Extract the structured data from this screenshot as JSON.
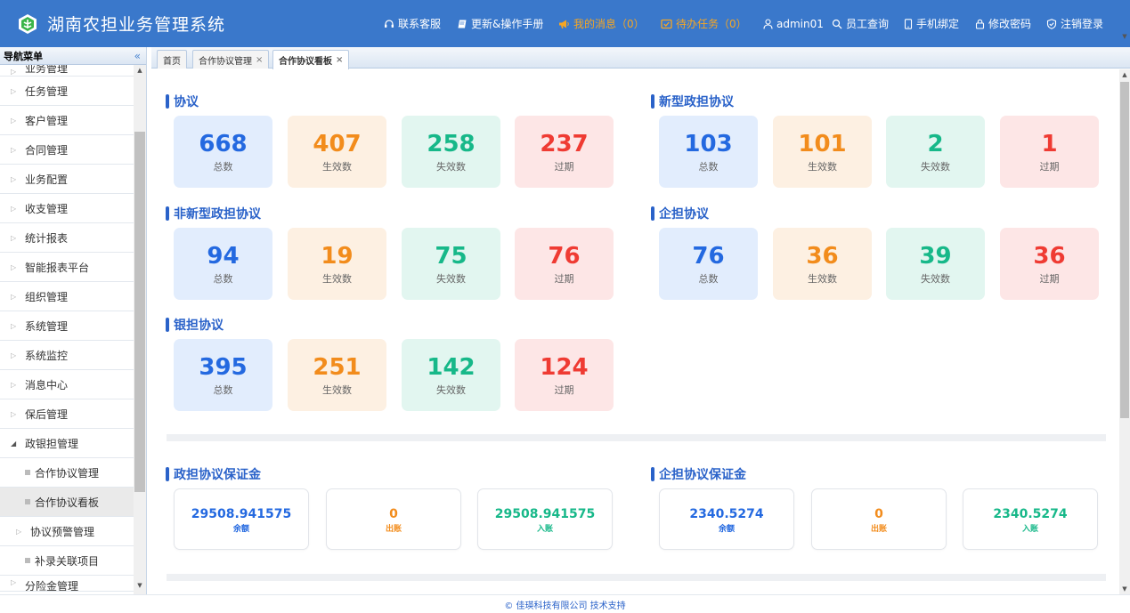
{
  "header": {
    "app_title": "湖南农担业务管理系统",
    "nav": {
      "support": "联系客服",
      "manual": "更新&操作手册",
      "messages": "我的消息（0）",
      "tasks": "待办任务（0）",
      "user": "admin01",
      "staff_search": "员工查询",
      "phone_bind": "手机绑定",
      "change_password": "修改密码",
      "logout": "注销登录"
    },
    "colors": {
      "bar": "#3a78cb",
      "highlight": "#f6a623"
    }
  },
  "sidebar": {
    "title": "导航菜单",
    "collapse_icon": "double-chevron-left-icon",
    "items": [
      {
        "label": "业务管理"
      },
      {
        "label": "任务管理"
      },
      {
        "label": "客户管理"
      },
      {
        "label": "合同管理"
      },
      {
        "label": "业务配置"
      },
      {
        "label": "收支管理"
      },
      {
        "label": "统计报表"
      },
      {
        "label": "智能报表平台"
      },
      {
        "label": "组织管理"
      },
      {
        "label": "系统管理"
      },
      {
        "label": "系统监控"
      },
      {
        "label": "消息中心"
      },
      {
        "label": "保后管理"
      },
      {
        "label": "政银担管理"
      },
      {
        "label": "合作协议管理"
      },
      {
        "label": "合作协议看板"
      },
      {
        "label": "协议预警管理"
      },
      {
        "label": "补录关联项目"
      },
      {
        "label": "分险金管理"
      }
    ]
  },
  "tabs": [
    {
      "label": "首页"
    },
    {
      "label": "合作协议管理"
    },
    {
      "label": "合作协议看板"
    }
  ],
  "sections": [
    {
      "title": "协议",
      "cards": [
        {
          "value": "668",
          "label": "总数"
        },
        {
          "value": "407",
          "label": "生效数"
        },
        {
          "value": "258",
          "label": "失效数"
        },
        {
          "value": "237",
          "label": "过期"
        }
      ]
    },
    {
      "title": "新型政担协议",
      "cards": [
        {
          "value": "103",
          "label": "总数"
        },
        {
          "value": "101",
          "label": "生效数"
        },
        {
          "value": "2",
          "label": "失效数"
        },
        {
          "value": "1",
          "label": "过期"
        }
      ]
    },
    {
      "title": "非新型政担协议",
      "cards": [
        {
          "value": "94",
          "label": "总数"
        },
        {
          "value": "19",
          "label": "生效数"
        },
        {
          "value": "75",
          "label": "失效数"
        },
        {
          "value": "76",
          "label": "过期"
        }
      ]
    },
    {
      "title": "企担协议",
      "cards": [
        {
          "value": "76",
          "label": "总数"
        },
        {
          "value": "36",
          "label": "生效数"
        },
        {
          "value": "39",
          "label": "失效数"
        },
        {
          "value": "36",
          "label": "过期"
        }
      ]
    },
    {
      "title": "银担协议",
      "cards": [
        {
          "value": "395",
          "label": "总数"
        },
        {
          "value": "251",
          "label": "生效数"
        },
        {
          "value": "142",
          "label": "失效数"
        },
        {
          "value": "124",
          "label": "过期"
        }
      ]
    }
  ],
  "margins": [
    {
      "title": "政担协议保证金",
      "cards": [
        {
          "value": "29508.941575",
          "label": "余额"
        },
        {
          "value": "0",
          "label": "出账"
        },
        {
          "value": "29508.941575",
          "label": "入账"
        }
      ]
    },
    {
      "title": "企担协议保证金",
      "cards": [
        {
          "value": "2340.5274",
          "label": "余额"
        },
        {
          "value": "0",
          "label": "出账"
        },
        {
          "value": "2340.5274",
          "label": "入账"
        }
      ]
    }
  ],
  "card_colors": {
    "total": "#2469e0",
    "active": "#f28c1c",
    "inactive": "#17b889",
    "expired": "#ef3b33"
  },
  "footer": {
    "text": "© 佳瑛科技有限公司 技术支持"
  }
}
